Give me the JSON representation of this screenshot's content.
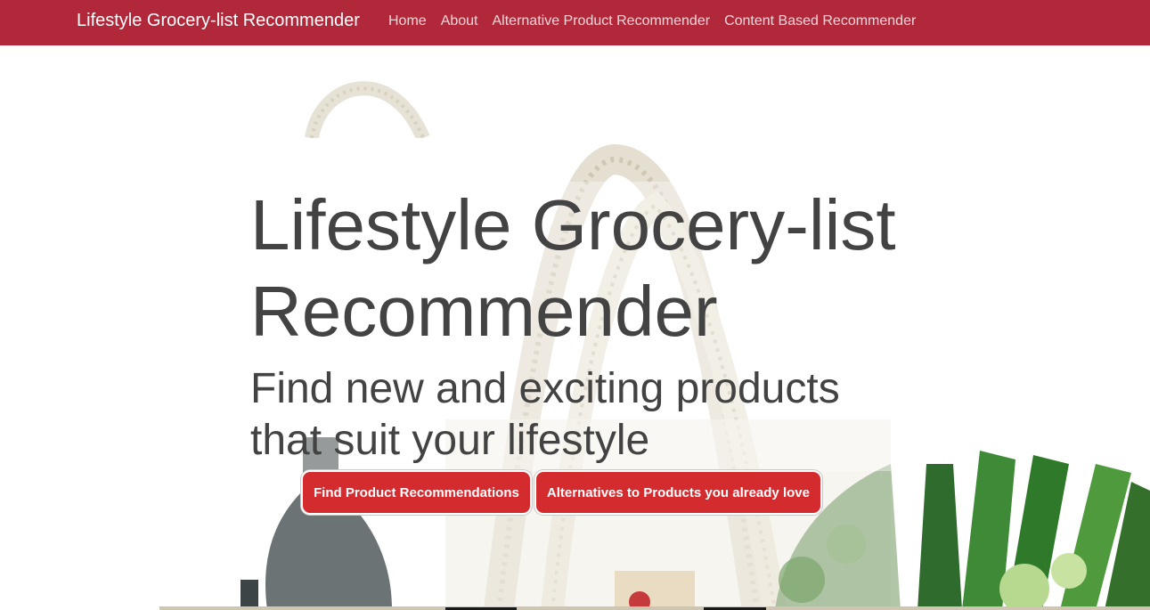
{
  "navbar": {
    "brand": "Lifestyle Grocery-list Recommender",
    "links": [
      {
        "label": "Home"
      },
      {
        "label": "About"
      },
      {
        "label": "Alternative Product Recommender"
      },
      {
        "label": "Content Based Recommender"
      }
    ],
    "color": "#b0283a"
  },
  "hero": {
    "title": "Lifestyle Grocery-list Recommender",
    "subtitle": "Find new and exciting products that suit your lifestyle",
    "buttons": [
      {
        "label": "Find Product Recommendations"
      },
      {
        "label": "Alternatives to Products you already love"
      }
    ],
    "button_color": "#d42b2f",
    "background_image": "grocery-bag-photo"
  }
}
